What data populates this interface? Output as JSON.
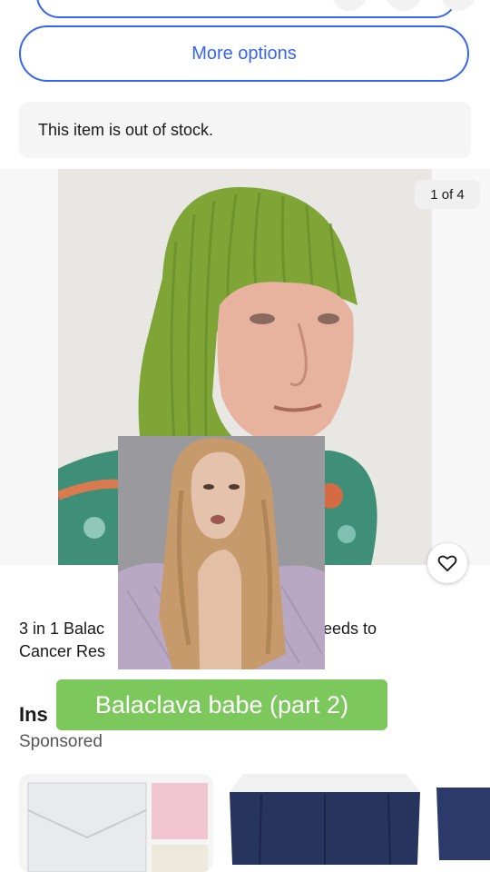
{
  "actions": {
    "more_options_label": "More options"
  },
  "availability": {
    "message": "This item is out of stock."
  },
  "gallery": {
    "counter": "1 of 4",
    "icons": {
      "watch": "heart-icon"
    }
  },
  "listing": {
    "title_line1": "3 in 1 Balac",
    "title_line1_tail": "eeds to",
    "title_line2": "Cancer Res"
  },
  "section": {
    "title": "Ins",
    "subtitle": "Sponsored"
  },
  "overlay": {
    "caption": "Balaclava babe (part 2)"
  },
  "colors": {
    "accent": "#3665f3",
    "caption_bg": "#7cc85c",
    "knit": "#7ea535"
  }
}
